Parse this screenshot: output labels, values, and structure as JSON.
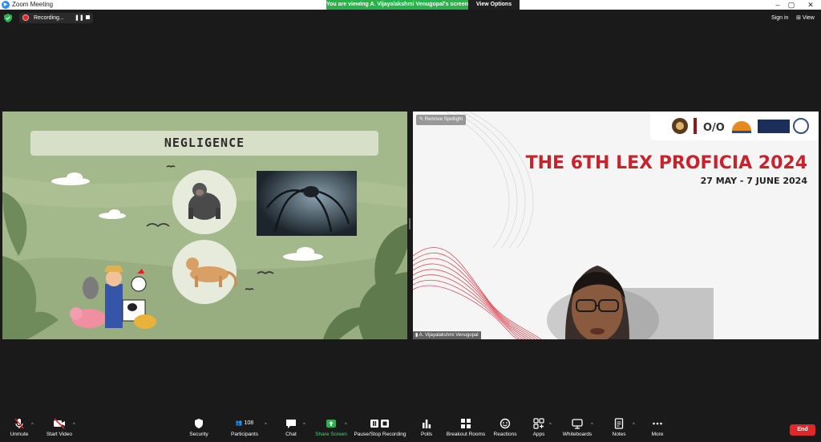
{
  "window": {
    "title": "Zoom Meeting",
    "share_banner": "You are viewing A. Vijayalakshmi Venugopal's screen",
    "view_options": "View Options",
    "minimize": "–",
    "maximize": "▢",
    "close": "✕"
  },
  "topbar": {
    "recording_label": "Recording...",
    "pause_glyph": "❚❚",
    "sign_in": "Sign in",
    "view": "View"
  },
  "left_tile": {
    "slide_title": "NEGLIGENCE"
  },
  "right_tile": {
    "remove_spotlight": "Remove Spotlight",
    "conference_title": "THE 6TH LEX PROFICIA 2024",
    "conference_dates": "27 MAY - 7 JUNE 2024",
    "name_tag": "A. Vijayalakshmi Venugopal"
  },
  "toolbar": {
    "unmute": "Unmute",
    "start_video": "Start Video",
    "security": "Security",
    "participants": "Participants",
    "participants_count": "108",
    "chat": "Chat",
    "share_screen": "Share Screen",
    "pause_stop_recording": "Pause/Stop Recording",
    "polls": "Polls",
    "breakout_rooms": "Breakout Rooms",
    "reactions": "Reactions",
    "apps": "Apps",
    "whiteboards": "Whiteboards",
    "notes": "Notes",
    "more": "More",
    "end": "End",
    "caret": "^"
  },
  "colors": {
    "share_green": "#27b24a",
    "end_red": "#e02828",
    "slide_green": "#a3b98b",
    "conference_red": "#c8232c"
  }
}
